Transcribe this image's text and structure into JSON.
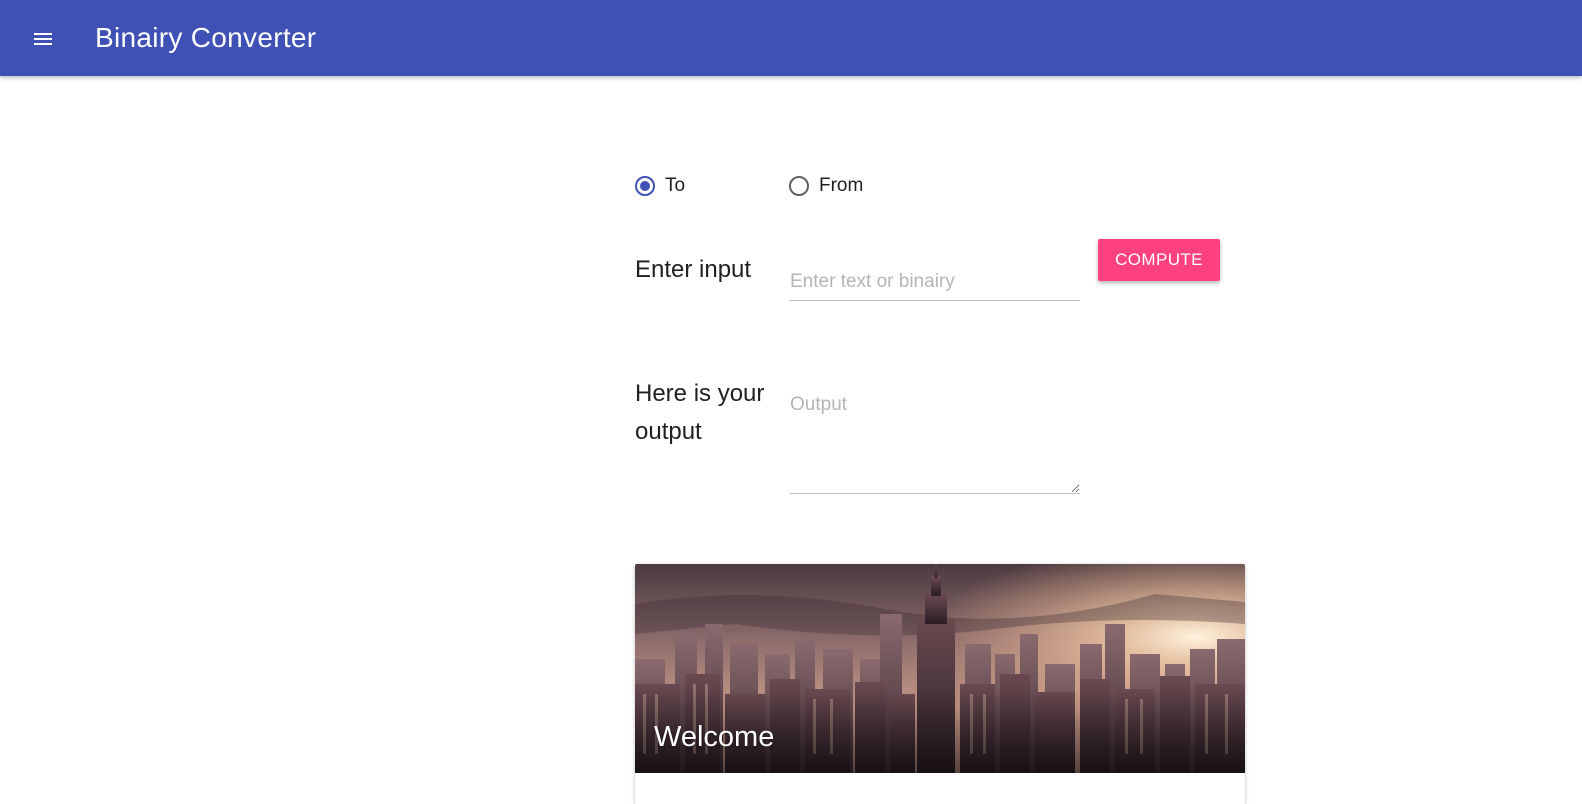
{
  "app_bar": {
    "title": "Binairy Converter",
    "menu_icon": "hamburger-menu-icon",
    "color": "#3f51b5"
  },
  "direction": {
    "options": [
      {
        "label": "To",
        "checked": true
      },
      {
        "label": "From",
        "checked": false
      }
    ]
  },
  "input_section": {
    "label": "Enter input",
    "placeholder": "Enter text or binairy",
    "value": "",
    "button_label": "COMPUTE",
    "button_color": "#ff4081"
  },
  "output_section": {
    "label_line1": "Here is your",
    "label_line2": "output",
    "placeholder": "Output",
    "value": ""
  },
  "card": {
    "title": "Welcome",
    "image": "city-skyline-image"
  }
}
